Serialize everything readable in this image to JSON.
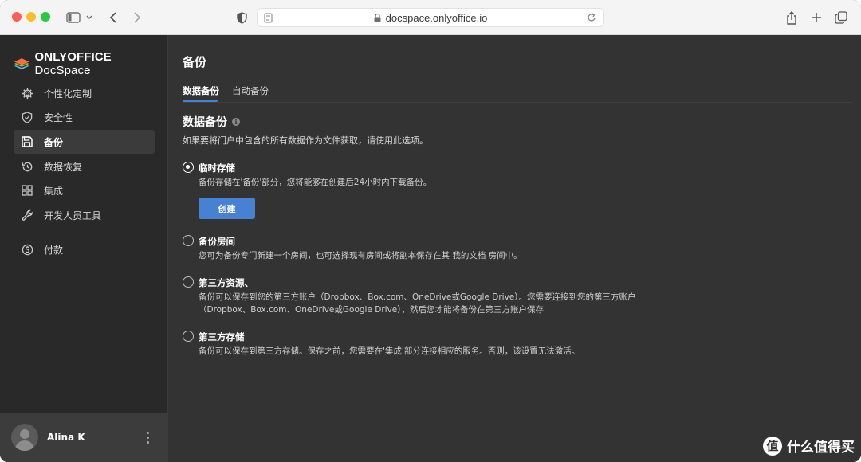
{
  "browser": {
    "url": "docspace.onlyoffice.io"
  },
  "app": {
    "logo_brand": "ONLYOFFICE",
    "logo_product": "DocSpace"
  },
  "sidebar": {
    "items": [
      {
        "label": "个性化定制",
        "icon": "gear-icon"
      },
      {
        "label": "安全性",
        "icon": "shield-icon"
      },
      {
        "label": "备份",
        "icon": "floppy-icon"
      },
      {
        "label": "数据恢复",
        "icon": "restore-icon"
      },
      {
        "label": "集成",
        "icon": "grid-icon"
      },
      {
        "label": "开发人员工具",
        "icon": "wrench-icon"
      },
      {
        "label": "付款",
        "icon": "dollar-icon"
      }
    ],
    "active_index": 2
  },
  "user": {
    "name": "Alina K"
  },
  "main": {
    "title": "备份",
    "tabs": [
      {
        "label": "数据备份",
        "active": true
      },
      {
        "label": "自动备份",
        "active": false
      }
    ],
    "section_title": "数据备份",
    "section_desc": "如果要将门户中包含的所有数据作为文件获取，请使用此选项。",
    "options": [
      {
        "title": "临时存储",
        "desc": "备份存储在'备份'部分，您将能够在创建后24小时内下载备份。",
        "checked": true
      },
      {
        "title": "备份房间",
        "desc": "您可为备份专门新建一个房间，也可选择现有房间或将副本保存在其 我的文档 房间中。",
        "checked": false
      },
      {
        "title": "第三方资源、",
        "desc": "备份可以保存到您的第三方账户（Dropbox、Box.com、OneDrive或Google Drive）。您需要连接到您的第三方账户",
        "desc2": "（Dropbox、Box.com、OneDrive或Google Drive），然后您才能将备份在第三方账户保存",
        "checked": false
      },
      {
        "title": "第三方存储",
        "desc": "备份可以保存到第三方存储。保存之前，您需要在'集成'部分连接相应的服务。否则，该设置无法激活。",
        "checked": false
      }
    ],
    "create_button": "创建"
  },
  "watermark": {
    "logo_char": "值",
    "text": "什么值得买"
  },
  "colors": {
    "accent": "#4781d1",
    "sidebar_bg": "#292929",
    "main_bg": "#333333"
  }
}
